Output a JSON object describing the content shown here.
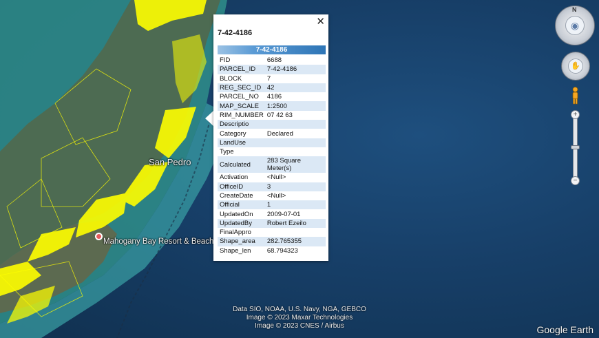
{
  "map": {
    "place_label": "San Pedro",
    "poi_label": "Mahogany Bay Resort & Beach C",
    "attribution": [
      "Data SIO, NOAA, U.S. Navy, NGA, GEBCO",
      "Image © 2023 Maxar Technologies",
      "Image © 2023 CNES / Airbus"
    ],
    "brand": "Google Earth",
    "parcel_color": "#ffff00"
  },
  "popup": {
    "title": "7-42-4186",
    "close_icon": "close-icon",
    "header": "7-42-4186",
    "rows": [
      {
        "key": "FID",
        "value": "6688"
      },
      {
        "key": "PARCEL_ID",
        "value": "7-42-4186"
      },
      {
        "key": "BLOCK",
        "value": "7"
      },
      {
        "key": "REG_SEC_ID",
        "value": "42"
      },
      {
        "key": "PARCEL_NO",
        "value": "4186"
      },
      {
        "key": "MAP_SCALE",
        "value": "1:2500"
      },
      {
        "key": "RIM_NUMBER",
        "value": "07 42 63"
      },
      {
        "key": "Descriptio",
        "value": ""
      },
      {
        "key": "Category",
        "value": "Declared"
      },
      {
        "key": "LandUse",
        "value": ""
      },
      {
        "key": "Type",
        "value": ""
      },
      {
        "key": "Calculated",
        "value": "283 Square Meter(s)"
      },
      {
        "key": "Activation",
        "value": "<Null>"
      },
      {
        "key": "OfficeID",
        "value": "3"
      },
      {
        "key": "CreateDate",
        "value": "<Null>"
      },
      {
        "key": "Official",
        "value": "1"
      },
      {
        "key": "UpdatedOn",
        "value": "2009-07-01"
      },
      {
        "key": "UpdatedBy",
        "value": "Robert Ezeilo"
      },
      {
        "key": "FinalAppro",
        "value": ""
      },
      {
        "key": "Shape_area",
        "value": "282.765355"
      },
      {
        "key": "Shape_len",
        "value": "68.794323"
      }
    ]
  },
  "controls": {
    "compass_letter": "N",
    "zoom_in": "+",
    "zoom_out": "−",
    "look_icon": "eye-icon",
    "move_icon": "hand-icon",
    "pegman_icon": "pegman-icon"
  }
}
